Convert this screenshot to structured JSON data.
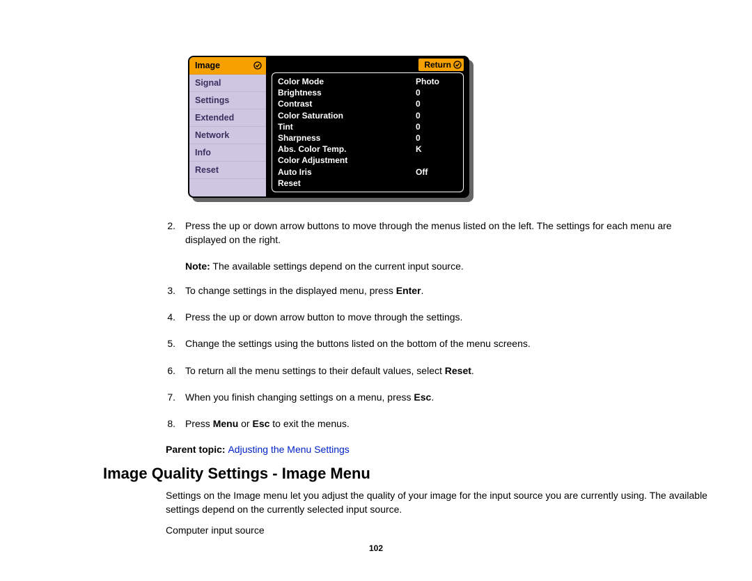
{
  "projector_menu": {
    "side_items": [
      "Image",
      "Signal",
      "Settings",
      "Extended",
      "Network",
      "Info",
      "Reset"
    ],
    "selected_index": 0,
    "return_label": "Return",
    "settings": [
      {
        "label": "Color Mode",
        "value": "Photo"
      },
      {
        "label": "Brightness",
        "value": "0"
      },
      {
        "label": "Contrast",
        "value": "0"
      },
      {
        "label": "Color Saturation",
        "value": "0"
      },
      {
        "label": "Tint",
        "value": "0"
      },
      {
        "label": "Sharpness",
        "value": "0"
      },
      {
        "label": "Abs. Color Temp.",
        "value": "K"
      },
      {
        "label": "Color Adjustment",
        "value": ""
      },
      {
        "label": "Auto Iris",
        "value": "Off"
      },
      {
        "label": "Reset",
        "value": ""
      }
    ]
  },
  "steps": {
    "s2a": "Press the up or down arrow buttons to move through the menus listed on the left. The settings for each menu are displayed on the right.",
    "s3": "To change settings in the displayed menu, press ",
    "s3b": "Enter",
    "s3c": ".",
    "s4": "Press the up or down arrow button to move through the settings.",
    "s5": "Change the settings using the buttons listed on the bottom of the menu screens.",
    "s6a": "To return all the menu settings to their default values, select ",
    "s6b": "Reset",
    "s6c": ".",
    "s7a": "When you finish changing settings on a menu, press ",
    "s7b": "Esc",
    "s7c": ".",
    "s8a": "Press ",
    "s8b": "Menu",
    "s8c": " or ",
    "s8d": "Esc",
    "s8e": " to exit the menus."
  },
  "note": {
    "label": "Note:",
    "text": " The available settings depend on the current input source."
  },
  "parent_topic": {
    "label": "Parent topic: ",
    "link": "Adjusting the Menu Settings"
  },
  "section": {
    "heading": "Image Quality Settings - Image Menu",
    "p1": "Settings on the Image menu let you adjust the quality of your image for the input source you are currently using. The available settings depend on the currently selected input source.",
    "p2": "Computer input source"
  },
  "page_number": "102",
  "list_numbers": {
    "n2": "2.",
    "n3": "3.",
    "n4": "4.",
    "n5": "5.",
    "n6": "6.",
    "n7": "7.",
    "n8": "8."
  }
}
